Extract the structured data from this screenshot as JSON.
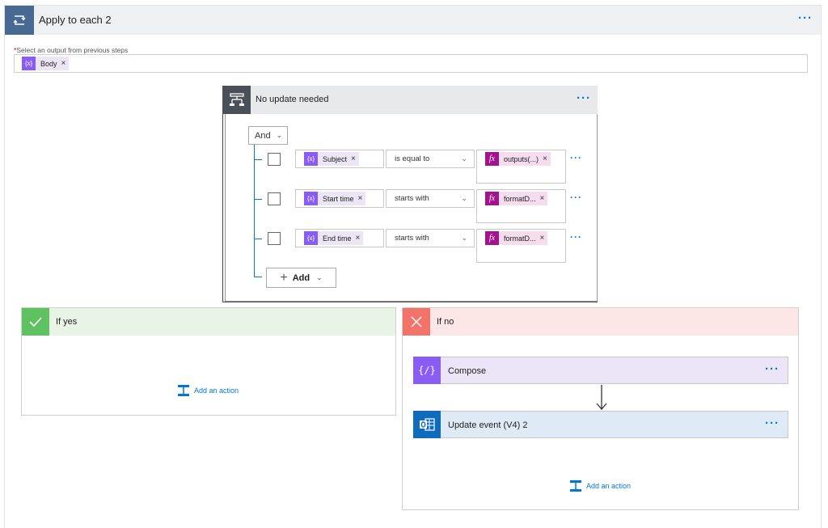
{
  "apply_each": {
    "title": "Apply to each 2",
    "more_label": "···",
    "select_required_mark": "*",
    "select_label": "Select an output from previous steps",
    "tokens": [
      {
        "label": "Body",
        "icon": "variable-icon",
        "remove": "×"
      }
    ]
  },
  "condition": {
    "title": "No update needed",
    "more_label": "···",
    "operator": "And",
    "rows": [
      {
        "left_token": "Subject",
        "operator": "is equal to",
        "right_token": "outputs(...)",
        "remove": "×",
        "more": "···"
      },
      {
        "left_token": "Start time",
        "operator": "starts with",
        "right_token": "formatD...",
        "remove": "×",
        "more": "···"
      },
      {
        "left_token": "End time",
        "operator": "starts with",
        "right_token": "formatD...",
        "remove": "×",
        "more": "···"
      }
    ],
    "add_label": "Add",
    "token_icon_text": "{x}",
    "fx_icon_text": "fx"
  },
  "if_yes": {
    "title": "If yes",
    "add_action": "Add an action"
  },
  "if_no": {
    "title": "If no",
    "actions": [
      {
        "title": "Compose",
        "icon": "compose-icon",
        "more": "···"
      },
      {
        "title": "Update event (V4) 2",
        "icon": "outlook-icon",
        "more": "···"
      }
    ],
    "add_action": "Add an action"
  },
  "colors": {
    "loop": "#486991",
    "condition": "#4b4f57",
    "yes": "#5dc25f",
    "no": "#f2736a",
    "variable_token": "#8a5cf6",
    "expression_token": "#a3138e",
    "outlook": "#0f6cbd",
    "link": "#0078d4"
  }
}
